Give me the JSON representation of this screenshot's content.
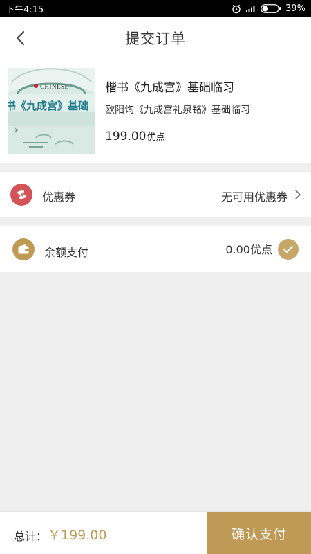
{
  "status_bar": {
    "time": "下午4:15",
    "battery": "39%",
    "battery_level": 0.39
  },
  "header": {
    "title": "提交订单"
  },
  "product": {
    "title": "楷书《九成宫》基础临习",
    "subtitle": "欧阳询《九成宫礼泉铭》基础临习",
    "price": "199.00",
    "price_unit": "优点",
    "thumb_brand": "CHINESE",
    "thumb_text": "书《九成宫》基础"
  },
  "coupon": {
    "label": "优惠券",
    "value": "无可用优惠券",
    "icon": "ticket-icon",
    "icon_color": "#d35358"
  },
  "balance": {
    "label": "余额支付",
    "value": "0.00优点",
    "icon": "wallet-icon",
    "icon_color": "#c09a54",
    "checked": true
  },
  "footer": {
    "total_label": "总计：",
    "total_value": "￥199.00",
    "confirm_label": "确认支付"
  },
  "colors": {
    "accent": "#bf9a57",
    "background": "#efefef"
  }
}
